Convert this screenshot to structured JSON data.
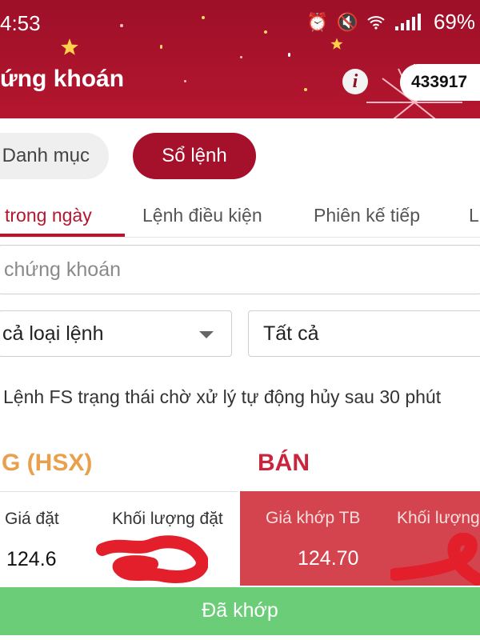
{
  "status_bar": {
    "time": "4:53",
    "battery": "69%",
    "icons": [
      "alarm-icon",
      "mute-icon",
      "wifi-icon",
      "signal-icon"
    ]
  },
  "header": {
    "title": "ứng khoán",
    "info_icon": "i",
    "account_number": "433917"
  },
  "segments": {
    "portfolio_label": "Danh mục",
    "orderbook_label": "Sổ lệnh",
    "active": "orderbook"
  },
  "tabs": [
    {
      "label": "trong ngày",
      "active": true
    },
    {
      "label": "Lệnh điều kiện",
      "active": false
    },
    {
      "label": "Phiên kế tiếp",
      "active": false
    },
    {
      "label": "L",
      "active": false
    }
  ],
  "search": {
    "placeholder": "chứng khoán"
  },
  "filters": {
    "order_type_value": "cả loại lệnh",
    "status_value": "Tất cả"
  },
  "notice": "Lệnh FS trạng thái chờ xử lý tự động hủy sau 30 phút",
  "order": {
    "symbol": "G (HSX)",
    "side": "BÁN",
    "price_label": "Giá đặt",
    "price_value": "124.6",
    "volume_label": "Khối lượng đặt",
    "avg_match_price_label": "Giá khớp TB",
    "avg_match_price_value": "124.70",
    "match_volume_label": "Khối lượng",
    "status": "Đã khớp"
  },
  "colors": {
    "brand_red": "#b5162f",
    "sell_red": "#d4444f",
    "matched_green": "#6ccd79",
    "symbol_orange": "#e9a04c"
  }
}
